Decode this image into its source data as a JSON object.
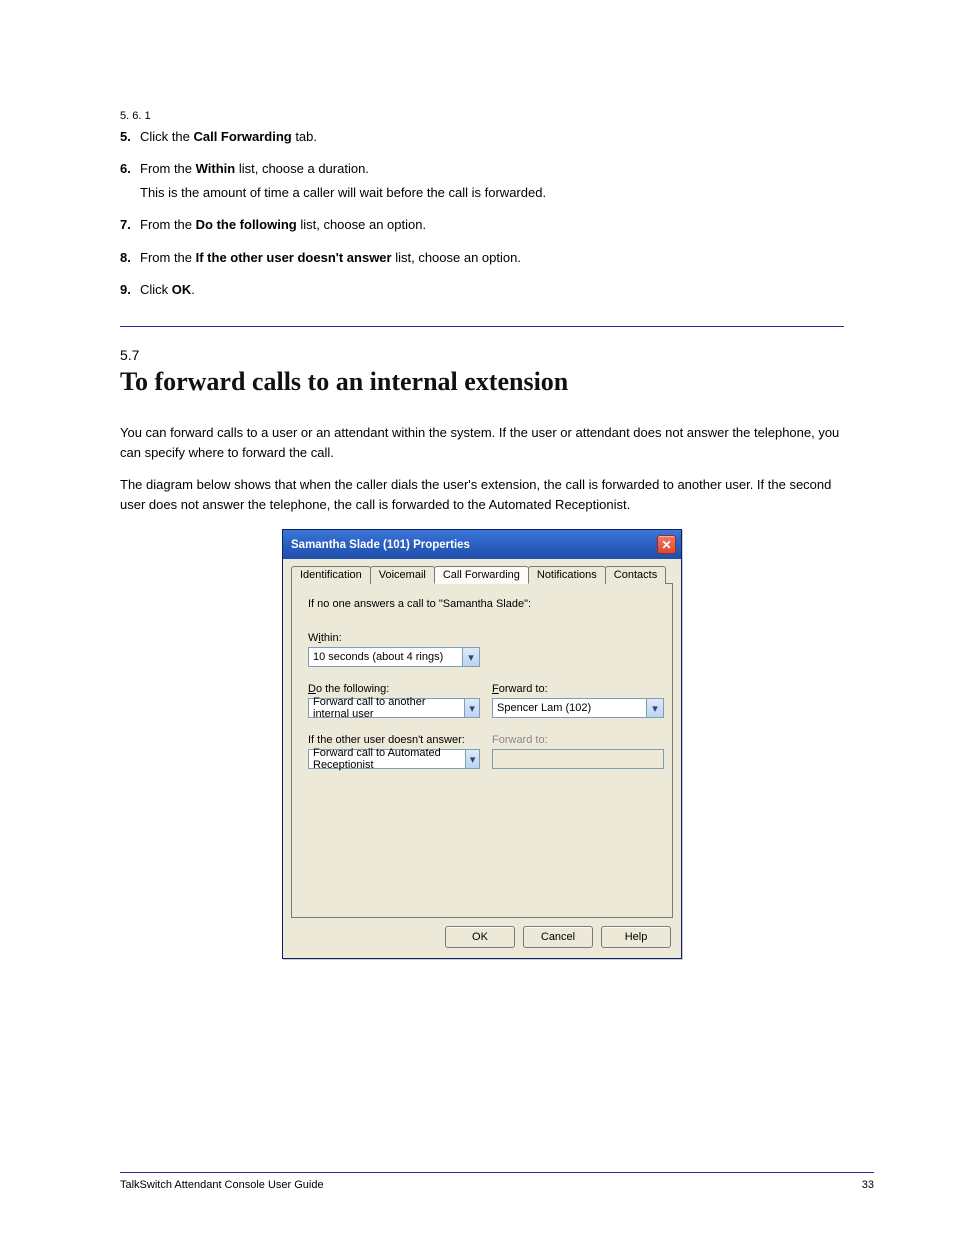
{
  "steps_header": {
    "section_num": "5. 6. 1"
  },
  "steps": [
    {
      "num": "5.",
      "text_a": "Click the ",
      "bold_a": "Call Forwarding",
      "text_b": " tab."
    },
    {
      "num": "6.",
      "text_a": "From the ",
      "bold_a": "Within",
      "text_b": " list, choose a duration.",
      "sub": "This is the amount of time a caller will wait before the call is forwarded."
    },
    {
      "num": "7.",
      "text_a": "From the ",
      "bold_a": "Do the following",
      "text_b": " list, choose an option."
    },
    {
      "num": "8.",
      "text_a": "From the ",
      "bold_a": "If the other user doesn't answer",
      "text_b": " list, choose an option."
    },
    {
      "num": "9.",
      "text_a": "Click ",
      "bold_a": "OK",
      "text_b": "."
    }
  ],
  "heading": {
    "num": "5.7",
    "title": "To forward calls to an internal extension"
  },
  "body": [
    "You can forward calls to a user or an attendant within the system. If the user or attendant does not answer the telephone, you can specify where to forward the call.",
    "The diagram below shows that when the caller dials the user's extension, the call is forwarded to another user. If the second user does not answer the telephone, the call is forwarded to the Automated Receptionist."
  ],
  "dialog": {
    "title": "Samantha Slade (101) Properties",
    "tabs": [
      "Identification",
      "Voicemail",
      "Call Forwarding",
      "Notifications",
      "Contacts"
    ],
    "active_tab": 2,
    "intro": "If no one answers a call to \"Samantha Slade\":",
    "fields": {
      "within_label_pre": "W",
      "within_label_und": "i",
      "within_label_post": "thin:",
      "within_value": "10 seconds (about 4 rings)",
      "do_label_und": "D",
      "do_label_post": "o the following:",
      "do_value": "Forward call to another internal user",
      "fwd1_label_und": "F",
      "fwd1_label_post": "orward to:",
      "fwd1_value": "Spencer Lam (102)",
      "if_label": "If the other user doesn't answer:",
      "if_value": "Forward call to Automated Receptionist",
      "fwd2_label": "Forward to:"
    },
    "buttons": {
      "ok": "OK",
      "cancel": "Cancel",
      "help": "Help"
    }
  },
  "footer": {
    "left": "TalkSwitch Attendant Console User Guide",
    "right": "33"
  }
}
